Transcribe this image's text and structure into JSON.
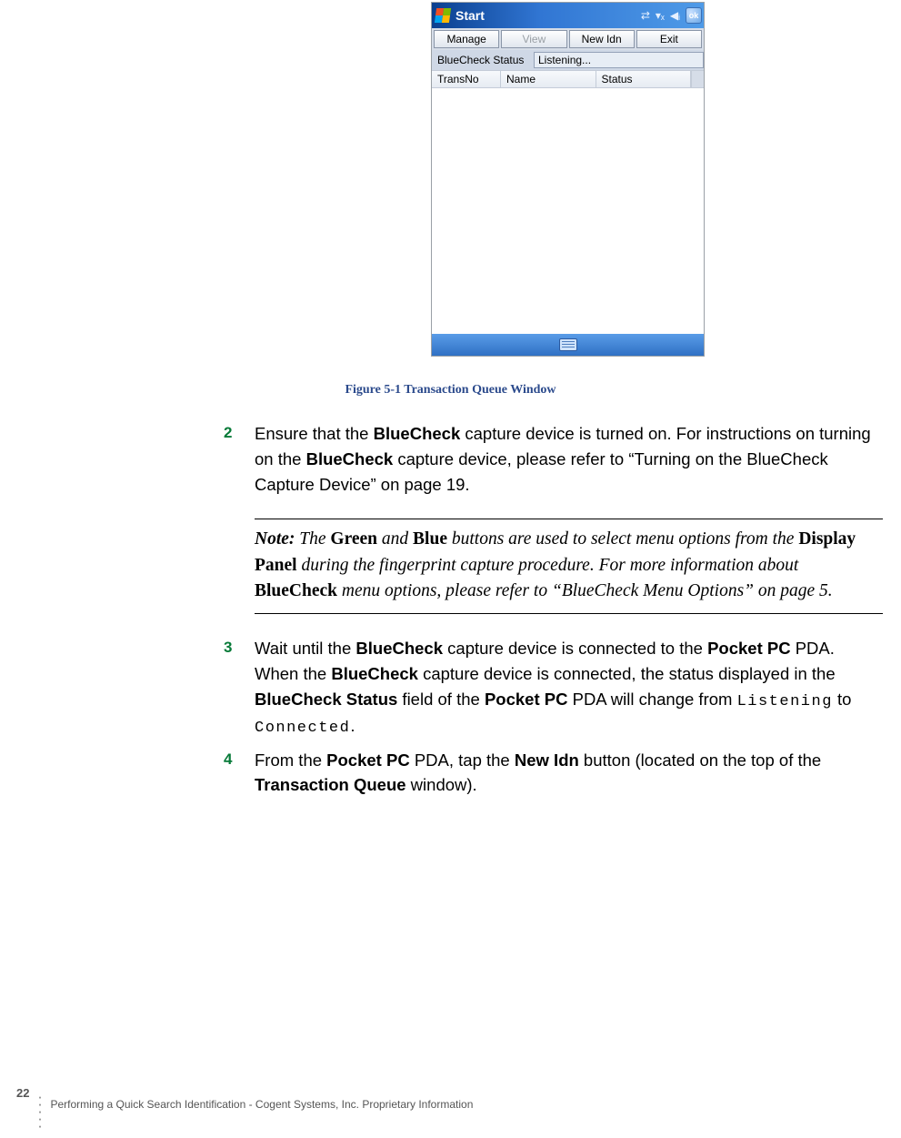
{
  "pda": {
    "start": "Start",
    "ok": "ok",
    "buttons": {
      "manage": "Manage",
      "view": "View",
      "newidn": "New Idn",
      "exit": "Exit"
    },
    "status_label": "BlueCheck Status",
    "status_value": "Listening...",
    "cols": {
      "c1": "TransNo",
      "c2": "Name",
      "c3": "Status"
    }
  },
  "figure_caption": "Figure 5-1 Transaction Queue Window",
  "steps": {
    "s2": {
      "num": "2",
      "t1": "Ensure that the ",
      "b1": "BlueCheck",
      "t2": " capture device is turned on. For instructions on turning on the ",
      "b2": "BlueCheck",
      "t3": " capture device, please refer to “Turning on the BlueCheck Capture Device” on page 19."
    },
    "note": {
      "head": "Note:",
      "t1": " The ",
      "b1": "Green",
      "t2": " and ",
      "b2": "Blue",
      "t3": " buttons are used to select menu options from the ",
      "b3": "Display Panel",
      "t4": " during the fingerprint capture procedure. For more information about ",
      "b4": "BlueCheck",
      "t5": " menu options, please refer to “BlueCheck Menu Options” on page 5."
    },
    "s3": {
      "num": "3",
      "t1": "Wait until the ",
      "b1": "BlueCheck",
      "t2": " capture device is connected to the ",
      "b2": "Pocket PC",
      "t3": " PDA. When the ",
      "b3": "BlueCheck",
      "t4": " capture device is connected, the status displayed in the ",
      "b4": "BlueCheck Status",
      "t5": " field of the ",
      "b5": "Pocket PC",
      "t6": " PDA will change from ",
      "m1": "Listening",
      "t7": " to ",
      "m2": "Connected",
      "t8": "."
    },
    "s4": {
      "num": "4",
      "t1": "From the ",
      "b1": "Pocket PC",
      "t2": " PDA, tap the ",
      "b2": "New Idn",
      "t3": " button (located on the top of the ",
      "b3": "Transaction Queue",
      "t4": " window)."
    }
  },
  "footer": {
    "page": "22",
    "text": "Performing a Quick Search Identification  - Cogent Systems, Inc. Proprietary Information"
  }
}
